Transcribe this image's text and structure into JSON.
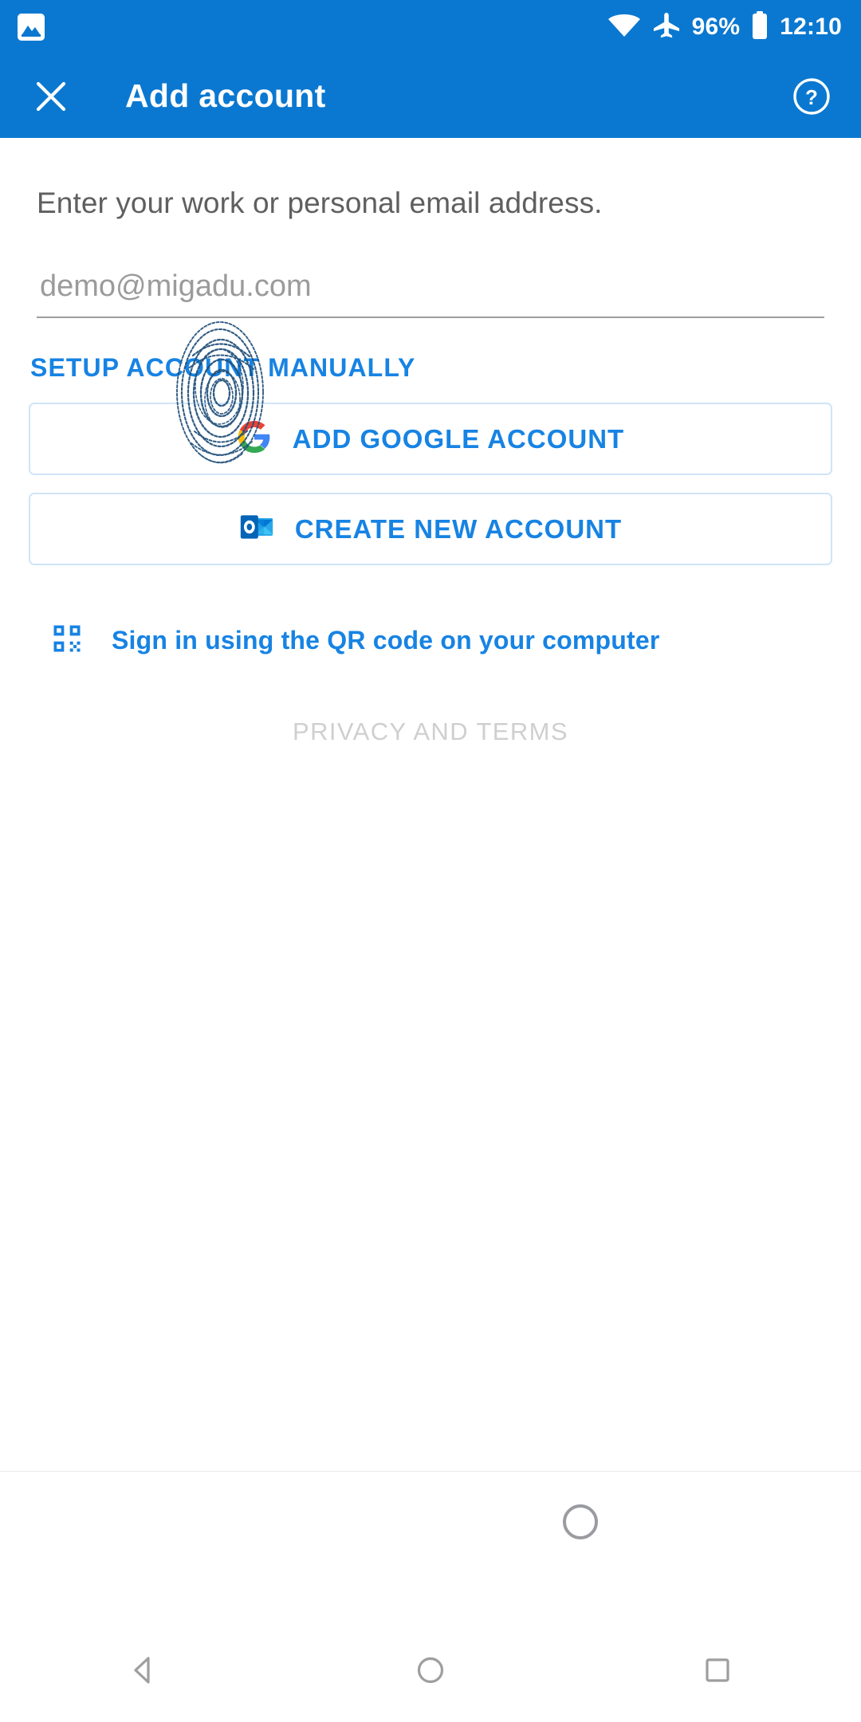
{
  "statusbar": {
    "notification_icon": "screenshot-image-icon",
    "wifi_icon": "wifi-icon",
    "airplane_icon": "airplane-mode-icon",
    "battery_percent": "96%",
    "battery_icon": "battery-full-icon",
    "time": "12:10",
    "background_color": "#0a78d0"
  },
  "appbar": {
    "close_icon": "close-icon",
    "title": "Add account",
    "help_icon": "help-circle-icon",
    "background_color": "#0a78d0"
  },
  "main": {
    "prompt": "Enter your work or personal email address.",
    "email_field": {
      "value": "",
      "placeholder": "demo@migadu.com"
    },
    "manual_setup_label": "SETUP ACCOUNT MANUALLY",
    "overlay_icon": "fingerprint-icon",
    "buttons": [
      {
        "label": "ADD GOOGLE ACCOUNT",
        "icon": "google-logo-icon"
      },
      {
        "label": "CREATE NEW ACCOUNT",
        "icon": "outlook-logo-icon"
      }
    ],
    "qr_signin": {
      "icon": "qr-code-icon",
      "label": "Sign in using the QR code on your computer"
    },
    "privacy_label": "PRIVACY AND TERMS"
  },
  "colors": {
    "accent_blue": "#1783e3",
    "brand_blue": "#0a78d0",
    "button_border": "#cfe4f7",
    "muted_gray": "#cfcfcf"
  },
  "navbar": {
    "back_icon": "back-triangle-icon",
    "home_icon": "home-circle-icon",
    "recents_icon": "recents-square-icon"
  }
}
